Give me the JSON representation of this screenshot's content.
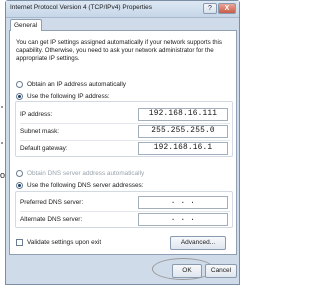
{
  "window": {
    "title": "Internet Protocol Version 4 (TCP/IPv4) Properties",
    "help_label": "?",
    "close_label": "X"
  },
  "tabs": [
    {
      "label": "General",
      "active": true
    }
  ],
  "intro": "You can get IP settings assigned automatically if your network supports this capability. Otherwise, you need to ask your network administrator for the appropriate IP settings.",
  "ip": {
    "auto_label": "Obtain an IP address automatically",
    "auto_selected": false,
    "manual_label": "Use the following IP address:",
    "manual_selected": true,
    "fields": [
      {
        "label": "IP address:",
        "value": "192.168.16.111"
      },
      {
        "label": "Subnet mask:",
        "value": "255.255.255.0"
      },
      {
        "label": "Default gateway:",
        "value": "192.168.16.1"
      }
    ]
  },
  "dns": {
    "auto_label": "Obtain DNS server address automatically",
    "auto_selected": false,
    "auto_enabled": false,
    "manual_label": "Use the following DNS server addresses:",
    "manual_selected": true,
    "fields": [
      {
        "label": "Preferred DNS server:",
        "value": ".      .      ."
      },
      {
        "label": "Alternate DNS server:",
        "value": ".      .      ."
      }
    ]
  },
  "validate": {
    "label": "Validate settings upon exit",
    "checked": false
  },
  "buttons": {
    "advanced": "Advanced...",
    "ok": "OK",
    "cancel": "Cancel"
  },
  "margin_text": {
    "o": "o"
  },
  "colors": {
    "window_frame": "#cfdbe8",
    "close_button": "#c95c48",
    "panel": "#ffffff"
  }
}
